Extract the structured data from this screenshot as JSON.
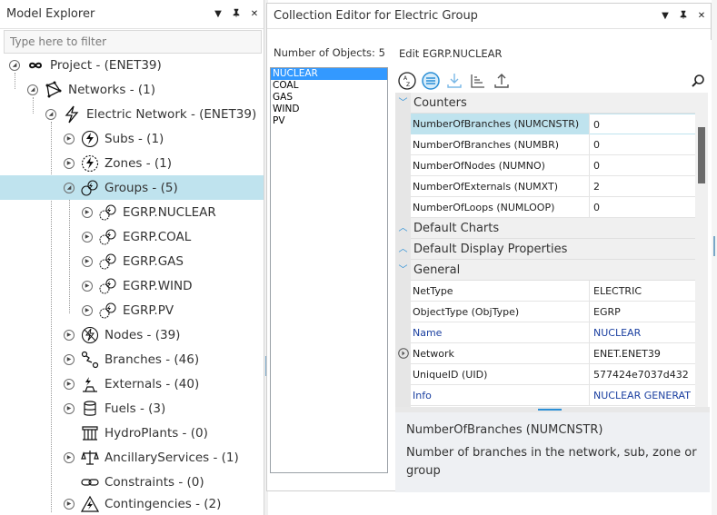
{
  "explorer": {
    "title": "Model Explorer",
    "filter_placeholder": "Type here to filter",
    "items": [
      {
        "label": "Project - (ENET39)",
        "icon": "infinity-icon"
      },
      {
        "label": "Networks - (1)",
        "icon": "network-icon"
      },
      {
        "label": "Electric Network - (ENET39)",
        "icon": "lightning-icon"
      },
      {
        "label": "Subs - (1)",
        "icon": "subs-icon"
      },
      {
        "label": "Zones - (1)",
        "icon": "zones-icon"
      },
      {
        "label": "Groups - (5)",
        "icon": "groups-icon"
      },
      {
        "label": "EGRP.NUCLEAR",
        "icon": "group-item-icon"
      },
      {
        "label": "EGRP.COAL",
        "icon": "group-item-icon"
      },
      {
        "label": "EGRP.GAS",
        "icon": "group-item-icon"
      },
      {
        "label": "EGRP.WIND",
        "icon": "group-item-icon"
      },
      {
        "label": "EGRP.PV",
        "icon": "group-item-icon"
      },
      {
        "label": "Nodes - (39)",
        "icon": "nodes-icon"
      },
      {
        "label": "Branches - (46)",
        "icon": "branches-icon"
      },
      {
        "label": "Externals - (40)",
        "icon": "externals-icon"
      },
      {
        "label": "Fuels - (3)",
        "icon": "fuels-icon"
      },
      {
        "label": "HydroPlants - (0)",
        "icon": "hydroplants-icon"
      },
      {
        "label": "AncillaryServices - (1)",
        "icon": "ancillary-icon"
      },
      {
        "label": "Constraints - (0)",
        "icon": "constraints-icon"
      },
      {
        "label": "Contingencies - (2)",
        "icon": "contingencies-icon"
      }
    ]
  },
  "editor": {
    "title": "Collection Editor for Electric Group",
    "object_count_label": "Number of Objects: 5",
    "objects": [
      "NUCLEAR",
      "COAL",
      "GAS",
      "WIND",
      "PV"
    ],
    "selected_object": "NUCLEAR",
    "edit_title": "Edit EGRP.NUCLEAR",
    "categories": {
      "counters": "Counters",
      "default_charts": "Default Charts",
      "default_display": "Default Display Properties",
      "general": "General"
    },
    "counters": [
      {
        "name": "NumberOfBranches (NUMCNSTR)",
        "value": "0"
      },
      {
        "name": "NumberOfBranches (NUMBR)",
        "value": "0"
      },
      {
        "name": "NumberOfNodes (NUMNO)",
        "value": "0"
      },
      {
        "name": "NumberOfExternals (NUMXT)",
        "value": "2"
      },
      {
        "name": "NumberOfLoops (NUMLOOP)",
        "value": "0"
      }
    ],
    "general": [
      {
        "name": "NetType",
        "value": "ELECTRIC"
      },
      {
        "name": "ObjectType (ObjType)",
        "value": "EGRP"
      },
      {
        "name": "Name",
        "value": "NUCLEAR"
      },
      {
        "name": "Network",
        "value": "ENET.ENET39"
      },
      {
        "name": "UniqueID (UID)",
        "value": "577424e7037d432"
      },
      {
        "name": "Info",
        "value": "NUCLEAR GENERAT"
      }
    ],
    "description": {
      "title": "NumberOfBranches (NUMCNSTR)",
      "text": "Number of branches in the network, sub, zone or group"
    }
  },
  "colors": {
    "selection": "#bfe3ee",
    "list_selection": "#3399ff",
    "accent": "#2b8fd6",
    "blue_text": "#1a3fa0"
  }
}
